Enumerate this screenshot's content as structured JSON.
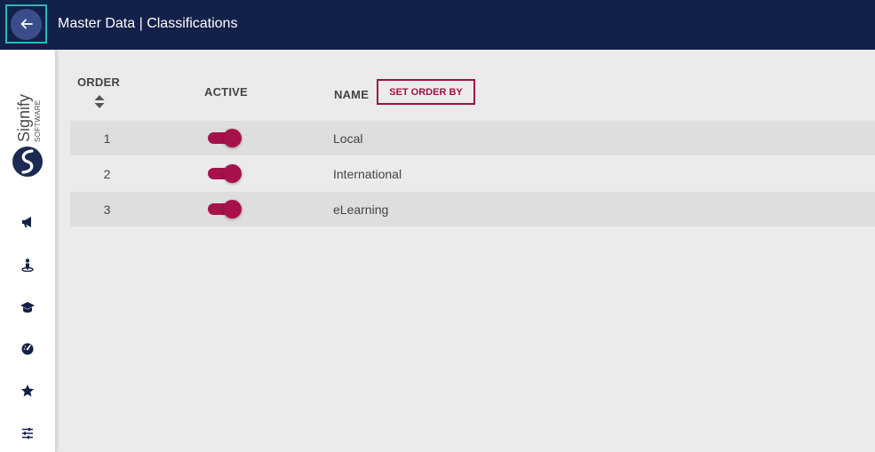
{
  "header": {
    "title": "Master Data | Classifications",
    "back_icon": "arrow-left-icon"
  },
  "sidebar": {
    "logo_text": "Signify",
    "logo_sub": "SOFTWARE",
    "items": [
      {
        "icon": "megaphone-icon"
      },
      {
        "icon": "person-pin-icon"
      },
      {
        "icon": "graduation-cap-icon"
      },
      {
        "icon": "speedometer-icon"
      },
      {
        "icon": "star-icon"
      },
      {
        "icon": "sliders-icon"
      }
    ]
  },
  "table": {
    "headers": {
      "order": "ORDER",
      "active": "ACTIVE",
      "name": "NAME"
    },
    "set_order_label": "SET ORDER BY",
    "rows": [
      {
        "order": "1",
        "active": true,
        "name": "Local"
      },
      {
        "order": "2",
        "active": true,
        "name": "International"
      },
      {
        "order": "3",
        "active": true,
        "name": "eLearning"
      }
    ]
  },
  "colors": {
    "header_bg": "#13214a",
    "accent": "#a8104c",
    "focus": "#26b8b8"
  }
}
